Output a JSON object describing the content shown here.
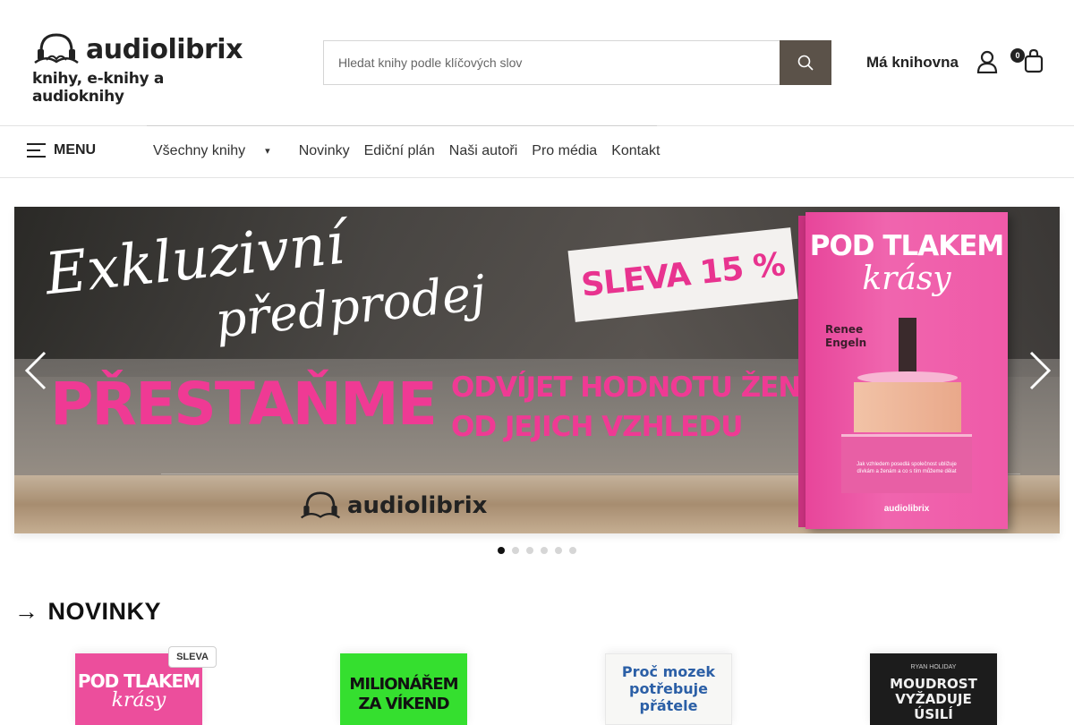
{
  "header": {
    "logo_name": "audiolibrix",
    "logo_tagline": "knihy, e-knihy a audioknihy",
    "search_placeholder": "Hledat knihy podle klíčových slov",
    "my_library": "Má knihovna",
    "cart_count": "0"
  },
  "nav": {
    "menu_label": "MENU",
    "links": [
      "Všechny knihy",
      "Novinky",
      "Ediční plán",
      "Naši autoři",
      "Pro média",
      "Kontakt"
    ]
  },
  "banner": {
    "script_line1": "Exkluzivní",
    "script_line2": "předprodej",
    "sale": "SLEVA 15 %",
    "headline": "PŘESTAŇME",
    "subline1": "ODVÍJET HODNOTU ŽEN",
    "subline2": "OD JEJICH VZHLEDU",
    "logo_name": "audiolibrix",
    "book": {
      "title_line1": "POD TLAKEM",
      "title_line2": "krásy",
      "author_line1": "Renee",
      "author_line2": "Engeln",
      "blurb": "Jak vzhledem posedlá společnost ubližuje dívkám a ženám a co s tím můžeme dělat",
      "publisher": "audiolibrix"
    },
    "slides_total": 6,
    "active_slide": 1
  },
  "section": {
    "arrow": "→",
    "title": "NOVINKY"
  },
  "products": [
    {
      "title_line1": "POD TLAKEM",
      "title_line2": "krásy",
      "badge": "SLEVA"
    },
    {
      "title_line1": "MILIONÁŘEM",
      "title_line2": "ZA VÍKEND"
    },
    {
      "title_line1": "Proč mozek",
      "title_line2": "potřebuje",
      "title_line3": "přátele"
    },
    {
      "author": "RYAN HOLIDAY",
      "title_line1": "MOUDROST",
      "title_line2": "VYŽADUJE",
      "title_line3": "ÚSILÍ"
    }
  ],
  "colors": {
    "search_button": "#5b5249",
    "accent_pink": "#ef3a94",
    "dot_active": "#111111"
  },
  "icons": [
    "headphones-book-logo-icon",
    "search-icon",
    "user-icon",
    "cart-icon",
    "hamburger-icon",
    "chevron-down-icon",
    "chevron-left-icon",
    "chevron-right-icon"
  ]
}
